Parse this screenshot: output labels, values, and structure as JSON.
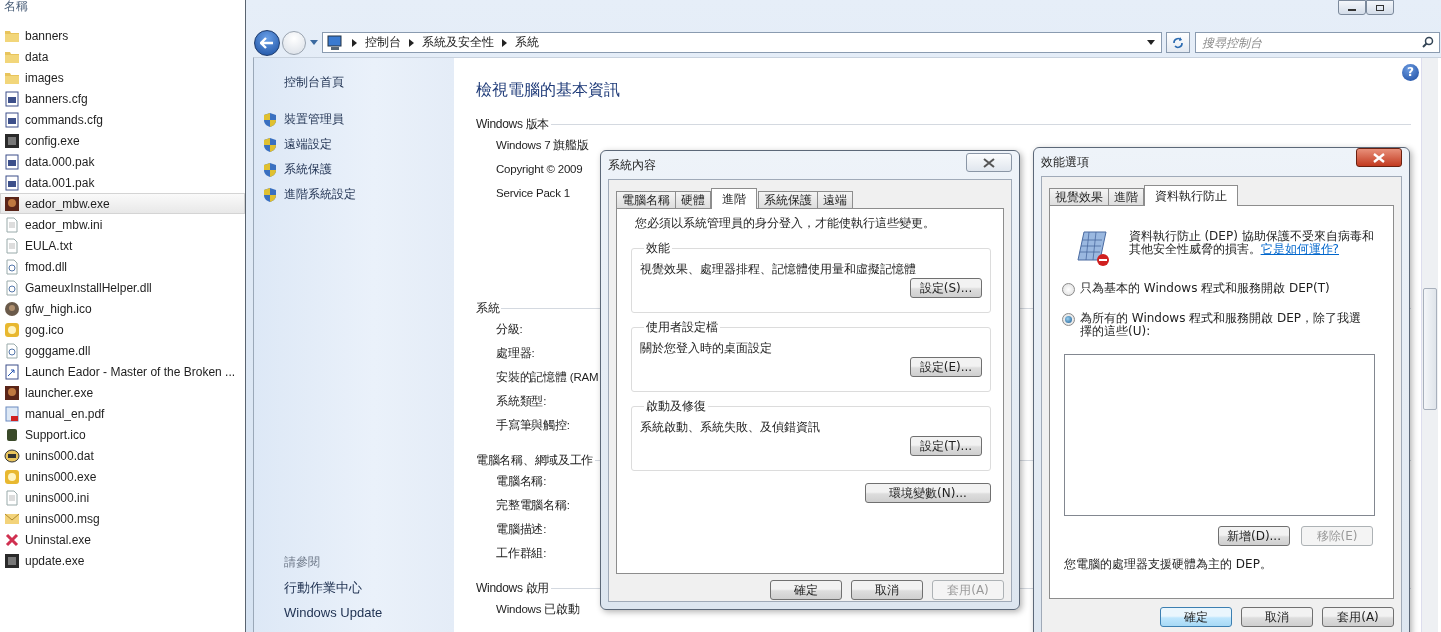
{
  "explorer": {
    "column_header": "名稱",
    "files": [
      {
        "name": "banners",
        "kind": "folder",
        "selected": false
      },
      {
        "name": "data",
        "kind": "folder",
        "selected": false
      },
      {
        "name": "images",
        "kind": "folder",
        "selected": false
      },
      {
        "name": "banners.cfg",
        "kind": "config",
        "selected": false
      },
      {
        "name": "commands.cfg",
        "kind": "config",
        "selected": false
      },
      {
        "name": "config.exe",
        "kind": "app",
        "selected": false
      },
      {
        "name": "data.000.pak",
        "kind": "config",
        "selected": false
      },
      {
        "name": "data.001.pak",
        "kind": "config",
        "selected": false
      },
      {
        "name": "eador_mbw.exe",
        "kind": "game",
        "selected": true
      },
      {
        "name": "eador_mbw.ini",
        "kind": "text",
        "selected": false
      },
      {
        "name": "EULA.txt",
        "kind": "text",
        "selected": false
      },
      {
        "name": "fmod.dll",
        "kind": "dll",
        "selected": false
      },
      {
        "name": "GameuxInstallHelper.dll",
        "kind": "dll",
        "selected": false
      },
      {
        "name": "gfw_high.ico",
        "kind": "image",
        "selected": false
      },
      {
        "name": "gog.ico",
        "kind": "disc",
        "selected": false
      },
      {
        "name": "goggame.dll",
        "kind": "dll",
        "selected": false
      },
      {
        "name": "Launch Eador - Master of the Broken ...",
        "kind": "shortcut",
        "selected": false
      },
      {
        "name": "launcher.exe",
        "kind": "game",
        "selected": false
      },
      {
        "name": "manual_en.pdf",
        "kind": "pdf",
        "selected": false
      },
      {
        "name": "Support.ico",
        "kind": "support",
        "selected": false
      },
      {
        "name": "unins000.dat",
        "kind": "dat",
        "selected": false
      },
      {
        "name": "unins000.exe",
        "kind": "disc",
        "selected": false
      },
      {
        "name": "unins000.ini",
        "kind": "text",
        "selected": false
      },
      {
        "name": "unins000.msg",
        "kind": "mail",
        "selected": false
      },
      {
        "name": "Uninstal.exe",
        "kind": "uninstall",
        "selected": false
      },
      {
        "name": "update.exe",
        "kind": "app",
        "selected": false
      }
    ]
  },
  "control_panel": {
    "breadcrumb": [
      "控制台",
      "系統及安全性",
      "系統"
    ],
    "search": {
      "placeholder": "搜尋控制台"
    },
    "help": "?",
    "sidebar": {
      "home": "控制台首頁",
      "links": [
        "裝置管理員",
        "遠端設定",
        "系統保護",
        "進階系統設定"
      ],
      "see_also_title": "請參閱",
      "see_also": [
        "行動作業中心",
        "Windows Update"
      ]
    },
    "heading": "檢視電腦的基本資訊",
    "sections": [
      {
        "title": "Windows 版本",
        "items": [
          "Windows 7 旗艦版",
          "Copyright © 2009",
          "Service Pack 1"
        ]
      },
      {
        "title": "系統",
        "items": [
          "分級:",
          "處理器:",
          "安裝的記憶體 (RAM",
          "系統類型:",
          "手寫筆與觸控:"
        ]
      },
      {
        "title": "電腦名稱、網域及工作",
        "items": [
          "電腦名稱:",
          "完整電腦名稱:",
          "電腦描述:",
          "工作群組:"
        ]
      },
      {
        "title": "Windows 啟用",
        "items": [
          "Windows 已啟動"
        ]
      }
    ]
  },
  "system_properties": {
    "title": "系統內容",
    "tabs": [
      {
        "label": "電腦名稱",
        "selected": false
      },
      {
        "label": "硬體",
        "selected": false
      },
      {
        "label": "進階",
        "selected": true
      },
      {
        "label": "系統保護",
        "selected": false
      },
      {
        "label": "遠端",
        "selected": false
      }
    ],
    "notice": "您必須以系統管理員的身分登入，才能使執行這些變更。",
    "groups": [
      {
        "title": "效能",
        "description": "視覺效果、處理器排程、記憶體使用量和虛擬記憶體",
        "button": "設定(S)..."
      },
      {
        "title": "使用者設定檔",
        "description": "關於您登入時的桌面設定",
        "button": "設定(E)..."
      },
      {
        "title": "啟動及修復",
        "description": "系統啟動、系統失敗、及偵錯資訊",
        "button": "設定(T)..."
      }
    ],
    "environment_button": "環境變數(N)...",
    "buttons": [
      {
        "label": "確定",
        "disabled": false
      },
      {
        "label": "取消",
        "disabled": false
      },
      {
        "label": "套用(A)",
        "disabled": true
      }
    ]
  },
  "performance_options": {
    "title": "效能選項",
    "tabs": [
      {
        "label": "視覺效果",
        "selected": false
      },
      {
        "label": "進階",
        "selected": false
      },
      {
        "label": "資料執行防止",
        "selected": true
      }
    ],
    "description": "資料執行防止 (DEP) 協助保護不受來自病毒和其他安全性威脅的損害。",
    "help_link": "它是如何運作?",
    "options": [
      {
        "label": "只為基本的 Windows 程式和服務開啟 DEP(T)",
        "selected": false
      },
      {
        "label": "為所有的 Windows 程式和服務開啟 DEP，除了我選擇的這些(U):",
        "selected": true
      }
    ],
    "list_buttons": [
      {
        "label": "新增(D)...",
        "disabled": false
      },
      {
        "label": "移除(E)",
        "disabled": true
      }
    ],
    "status": "您電腦的處理器支援硬體為主的 DEP。",
    "buttons": [
      {
        "label": "確定",
        "disabled": false
      },
      {
        "label": "取消",
        "disabled": false
      },
      {
        "label": "套用(A)",
        "disabled": false
      }
    ]
  }
}
